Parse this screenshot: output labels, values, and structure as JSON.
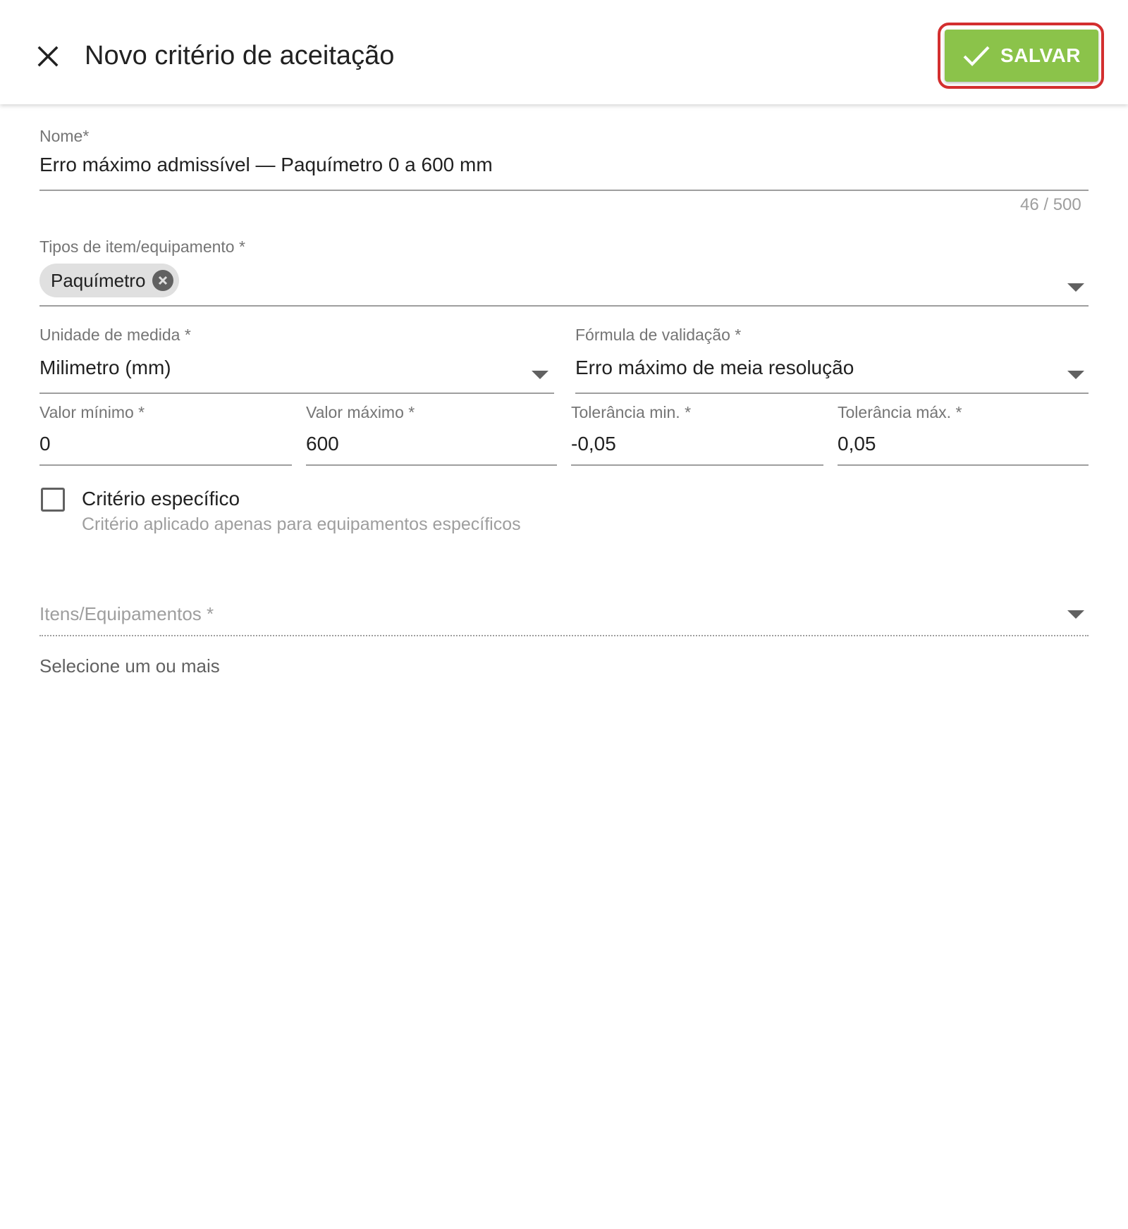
{
  "header": {
    "title": "Novo critério de aceitação",
    "close_icon": "close-icon",
    "save_label": "SALVAR",
    "save_icon": "check-icon",
    "save_color": "#8bc34a",
    "highlight_color": "#d32f2f"
  },
  "form": {
    "name": {
      "label": "Nome*",
      "value": "Erro máximo admissível — Paquímetro 0 a 600 mm",
      "counter": "46 / 500"
    },
    "item_types": {
      "label": "Tipos de item/equipamento *",
      "chips": [
        "Paquímetro"
      ]
    },
    "unit": {
      "label": "Unidade de medida *",
      "value": "Milimetro (mm)"
    },
    "formula": {
      "label": "Fórmula de validação *",
      "value": "Erro máximo de meia resolução"
    },
    "min_value": {
      "label": "Valor mínimo *",
      "value": "0"
    },
    "max_value": {
      "label": "Valor máximo *",
      "value": "600"
    },
    "tol_min": {
      "label": "Tolerância min. *",
      "value": "-0,05"
    },
    "tol_max": {
      "label": "Tolerância máx. *",
      "value": "0,05"
    },
    "specific": {
      "label": "Critério específico",
      "help": "Critério aplicado apenas para equipamentos específicos",
      "checked": false
    },
    "items": {
      "label": "Itens/Equipamentos *",
      "hint": "Selecione um ou mais"
    }
  }
}
